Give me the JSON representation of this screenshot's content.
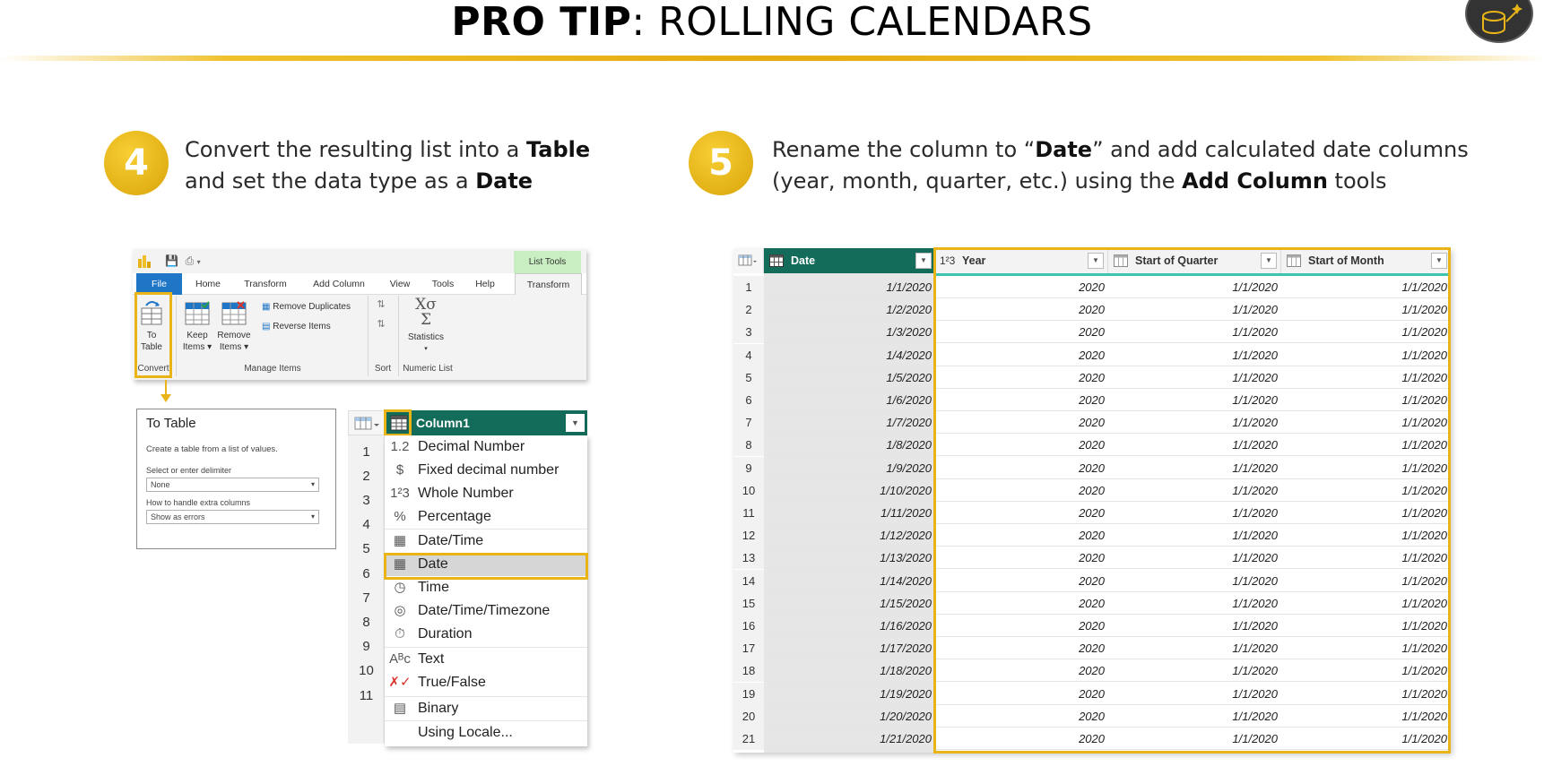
{
  "header": {
    "title_bold": "PRO TIP",
    "title_rest": ": ROLLING CALENDARS"
  },
  "steps": [
    {
      "number": "4",
      "line1_pre": "Convert the resulting list into a ",
      "line1_bold": "Table",
      "line2_pre": "and set the data type as a ",
      "line2_bold": "Date"
    },
    {
      "number": "5",
      "line1_pre": "Rename the column to “",
      "line1_bold": "Date",
      "line1_post": "” and add calculated date columns",
      "line2_pre": "(year, month, quarter, etc.) using the ",
      "line2_bold": "Add Column",
      "line2_post": " tools"
    }
  ],
  "ribbon": {
    "context_tab": "List Tools",
    "tabs": [
      "File",
      "Home",
      "Transform",
      "Add Column",
      "View",
      "Tools",
      "Help",
      "Transform"
    ],
    "to_table": [
      "To",
      "Table"
    ],
    "keep_items": [
      "Keep",
      "Items ▾"
    ],
    "remove_items": [
      "Remove",
      "Items ▾"
    ],
    "remove_duplicates": "Remove Duplicates",
    "reverse_items": "Reverse Items",
    "statistics": "Statistics",
    "statistics_symbol": "Xσ",
    "sigma": "Σ",
    "groups": [
      "Convert",
      "Manage Items",
      "Sort",
      "Numeric List"
    ]
  },
  "dialog": {
    "title": "To Table",
    "description": "Create a table from a list of values.",
    "delimiter_label": "Select or enter delimiter",
    "delimiter_value": "None",
    "extra_label": "How to handle extra columns",
    "extra_value": "Show as errors"
  },
  "type_menu": {
    "column": "Column1",
    "row_numbers": [
      "1",
      "2",
      "3",
      "4",
      "5",
      "6",
      "7",
      "8",
      "9",
      "10",
      "11"
    ],
    "items": [
      {
        "icon": "1.2",
        "label": "Decimal Number"
      },
      {
        "icon": "$",
        "label": "Fixed decimal number"
      },
      {
        "icon": "1²3",
        "label": "Whole Number"
      },
      {
        "icon": "%",
        "label": "Percentage"
      },
      {
        "icon": "▦",
        "label": "Date/Time"
      },
      {
        "icon": "▦",
        "label": "Date"
      },
      {
        "icon": "◷",
        "label": "Time"
      },
      {
        "icon": "◎",
        "label": "Date/Time/Timezone"
      },
      {
        "icon": "⏱",
        "label": "Duration"
      },
      {
        "icon": "Aᴮc",
        "label": "Text"
      },
      {
        "icon": "✗✓",
        "label": "True/False"
      },
      {
        "icon": "▤",
        "label": "Binary"
      },
      {
        "icon": "",
        "label": "Using Locale..."
      }
    ]
  },
  "grid": {
    "columns": [
      {
        "label": "Date",
        "icon": "calendar"
      },
      {
        "label": "Year",
        "icon": "1²3"
      },
      {
        "label": "Start of Quarter",
        "icon": "calendar"
      },
      {
        "label": "Start of Month",
        "icon": "calendar"
      }
    ],
    "rows": [
      [
        "1",
        "1/1/2020",
        "2020",
        "1/1/2020",
        "1/1/2020"
      ],
      [
        "2",
        "1/2/2020",
        "2020",
        "1/1/2020",
        "1/1/2020"
      ],
      [
        "3",
        "1/3/2020",
        "2020",
        "1/1/2020",
        "1/1/2020"
      ],
      [
        "4",
        "1/4/2020",
        "2020",
        "1/1/2020",
        "1/1/2020"
      ],
      [
        "5",
        "1/5/2020",
        "2020",
        "1/1/2020",
        "1/1/2020"
      ],
      [
        "6",
        "1/6/2020",
        "2020",
        "1/1/2020",
        "1/1/2020"
      ],
      [
        "7",
        "1/7/2020",
        "2020",
        "1/1/2020",
        "1/1/2020"
      ],
      [
        "8",
        "1/8/2020",
        "2020",
        "1/1/2020",
        "1/1/2020"
      ],
      [
        "9",
        "1/9/2020",
        "2020",
        "1/1/2020",
        "1/1/2020"
      ],
      [
        "10",
        "1/10/2020",
        "2020",
        "1/1/2020",
        "1/1/2020"
      ],
      [
        "11",
        "1/11/2020",
        "2020",
        "1/1/2020",
        "1/1/2020"
      ],
      [
        "12",
        "1/12/2020",
        "2020",
        "1/1/2020",
        "1/1/2020"
      ],
      [
        "13",
        "1/13/2020",
        "2020",
        "1/1/2020",
        "1/1/2020"
      ],
      [
        "14",
        "1/14/2020",
        "2020",
        "1/1/2020",
        "1/1/2020"
      ],
      [
        "15",
        "1/15/2020",
        "2020",
        "1/1/2020",
        "1/1/2020"
      ],
      [
        "16",
        "1/16/2020",
        "2020",
        "1/1/2020",
        "1/1/2020"
      ],
      [
        "17",
        "1/17/2020",
        "2020",
        "1/1/2020",
        "1/1/2020"
      ],
      [
        "18",
        "1/18/2020",
        "2020",
        "1/1/2020",
        "1/1/2020"
      ],
      [
        "19",
        "1/19/2020",
        "2020",
        "1/1/2020",
        "1/1/2020"
      ],
      [
        "20",
        "1/20/2020",
        "2020",
        "1/1/2020",
        "1/1/2020"
      ],
      [
        "21",
        "1/21/2020",
        "2020",
        "1/1/2020",
        "1/1/2020"
      ]
    ]
  },
  "colors": {
    "accent_gold": "#e8b418",
    "header_teal": "#136c5a",
    "file_tab_blue": "#1f75c6",
    "context_tab_green": "#c9eec2"
  }
}
